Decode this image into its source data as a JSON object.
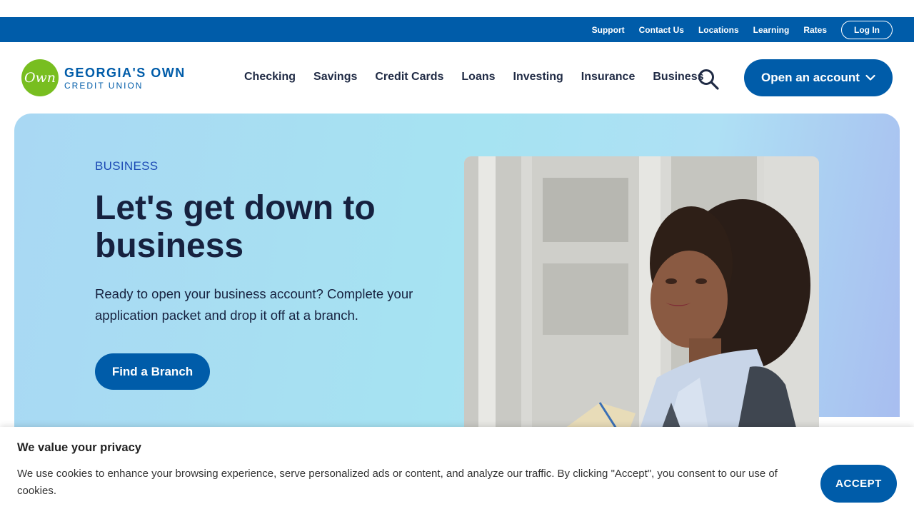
{
  "utility_nav": {
    "links": [
      "Support",
      "Contact Us",
      "Locations",
      "Learning",
      "Rates"
    ],
    "login_label": "Log In"
  },
  "logo": {
    "mark": "Own",
    "name": "GEORGIA'S OWN",
    "sub": "CREDIT UNION"
  },
  "main_nav": {
    "links": [
      "Checking",
      "Savings",
      "Credit Cards",
      "Loans",
      "Investing",
      "Insurance",
      "Business"
    ],
    "search_icon": "search-icon",
    "cta_label": "Open an account",
    "cta_icon": "chevron-down-icon"
  },
  "hero": {
    "eyebrow": "BUSINESS",
    "title": "Let's get down to business",
    "description": "Ready to open your business account? Complete your application packet and drop it off at a branch.",
    "button_label": "Find a Branch"
  },
  "cookie_banner": {
    "title": "We value your privacy",
    "text": "We use cookies to enhance your browsing experience, serve personalized ads or content, and analyze our traffic. By clicking \"Accept\", you consent to our use of cookies.",
    "accept_label": "ACCEPT"
  },
  "colors": {
    "brand_blue": "#005ca9",
    "brand_green": "#78be20",
    "heading_navy": "#16213f"
  }
}
